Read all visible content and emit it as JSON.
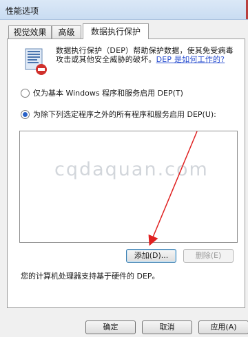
{
  "window": {
    "title": "性能选项"
  },
  "tabs": [
    "视觉效果",
    "高级",
    "数据执行保护"
  ],
  "dep": {
    "description": "数据执行保护（DEP）帮助保护数据，使其免受病毒攻击或其他安全威胁的破坏。",
    "link": "DEP 是如何工作的?",
    "option_basic": "仅为基本 Windows 程序和服务启用 DEP(T)",
    "option_all": "为除下列选定程序之外的所有程序和服务启用 DEP(U):",
    "watermark": "cqdaquan.com",
    "add_button": "添加(D)...",
    "remove_button": "删除(E)",
    "hardware_note": "您的计算机处理器支持基于硬件的 DEP。"
  },
  "buttons": {
    "ok": "确定",
    "cancel": "取消",
    "apply": "应用(A)"
  },
  "colors": {
    "annotation_arrow": "#e02020",
    "link": "#2a4fd0",
    "selected_radio": "#2a62c8"
  },
  "icons": [
    "dep-shield-icon",
    "radio-icon"
  ]
}
